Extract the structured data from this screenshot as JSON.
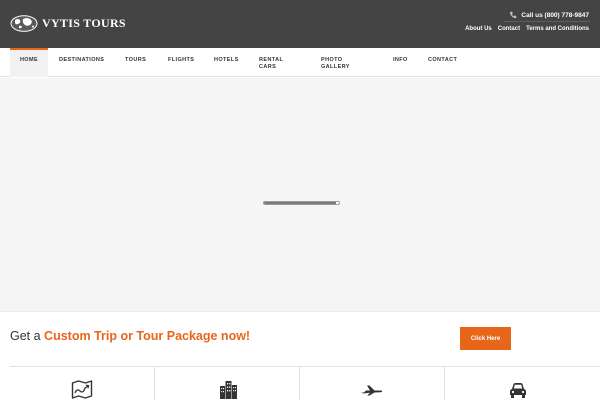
{
  "brand": {
    "name": "VYTIS TOURS",
    "logo_icon": "globe-icon"
  },
  "header": {
    "call_text": "Call us (800) 778-9847",
    "phone_icon": "phone-icon",
    "links": [
      "About Us",
      "Contact",
      "Terms and Conditions"
    ]
  },
  "nav": {
    "items": [
      "HOME",
      "DESTINATIONS",
      "TOURS",
      "FLIGHTS",
      "HOTELS",
      "RENTAL CARS",
      "PHOTO GALLERY",
      "INFO",
      "CONTACT"
    ],
    "active": "HOME"
  },
  "slider": {
    "loader_progress": 0.96
  },
  "cta": {
    "prefix": "Get a ",
    "highlight": "Custom Trip or Tour Package now!",
    "button": "Click Here"
  },
  "features": [
    "map-icon",
    "buildings-icon",
    "airplane-icon",
    "car-icon"
  ],
  "colors": {
    "accent": "#e8661a",
    "header_bg": "#444444",
    "slider_bg": "#f5f5f5"
  }
}
